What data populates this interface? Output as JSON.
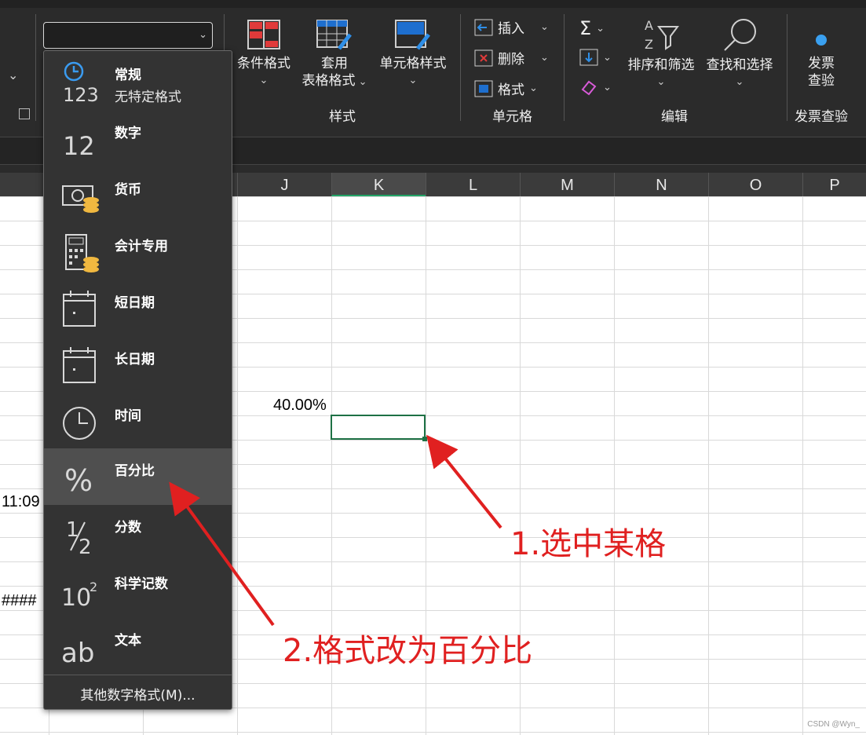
{
  "ribbon": {
    "styles_group": {
      "label": "样式",
      "conditional_format": "条件格式",
      "format_as_table": [
        "套用",
        "表格格式"
      ],
      "cell_styles": "单元格样式"
    },
    "cells_group": {
      "label": "单元格",
      "insert": "插入",
      "delete": "删除",
      "format": "格式"
    },
    "editing_group": {
      "label": "编辑",
      "sort_filter": "排序和筛选",
      "find_select": "查找和选择"
    },
    "invoice_group": {
      "label": "发票查验",
      "button": [
        "发票",
        "查验"
      ]
    }
  },
  "columns": [
    "J",
    "K",
    "L",
    "M",
    "N",
    "O",
    "P"
  ],
  "selected_column": "K",
  "cells": {
    "j_value": "40.00%",
    "left_time": "11:09",
    "left_hash": "####"
  },
  "number_format_menu": {
    "items": [
      {
        "label": "常规",
        "sub": "无特定格式",
        "icon": "general-123-icon"
      },
      {
        "label": "数字",
        "icon": "number-12-icon"
      },
      {
        "label": "货币",
        "icon": "currency-icon"
      },
      {
        "label": "会计专用",
        "icon": "accounting-icon"
      },
      {
        "label": "短日期",
        "icon": "calendar-icon"
      },
      {
        "label": "长日期",
        "icon": "calendar-icon"
      },
      {
        "label": "时间",
        "icon": "clock-icon"
      },
      {
        "label": "百分比",
        "icon": "percent-icon"
      },
      {
        "label": "分数",
        "icon": "fraction-icon"
      },
      {
        "label": "科学记数",
        "icon": "scientific-icon"
      },
      {
        "label": "文本",
        "icon": "text-ab-icon"
      }
    ],
    "more": "其他数字格式(M)..."
  },
  "annotations": {
    "step1": "1.选中某格",
    "step2": "2.格式改为百分比"
  },
  "watermark": "CSDN @Wyn_",
  "colors": {
    "ribbon_bg": "#2b2b2b",
    "selection_border": "#1e7145",
    "annotation_red": "#e02020"
  }
}
